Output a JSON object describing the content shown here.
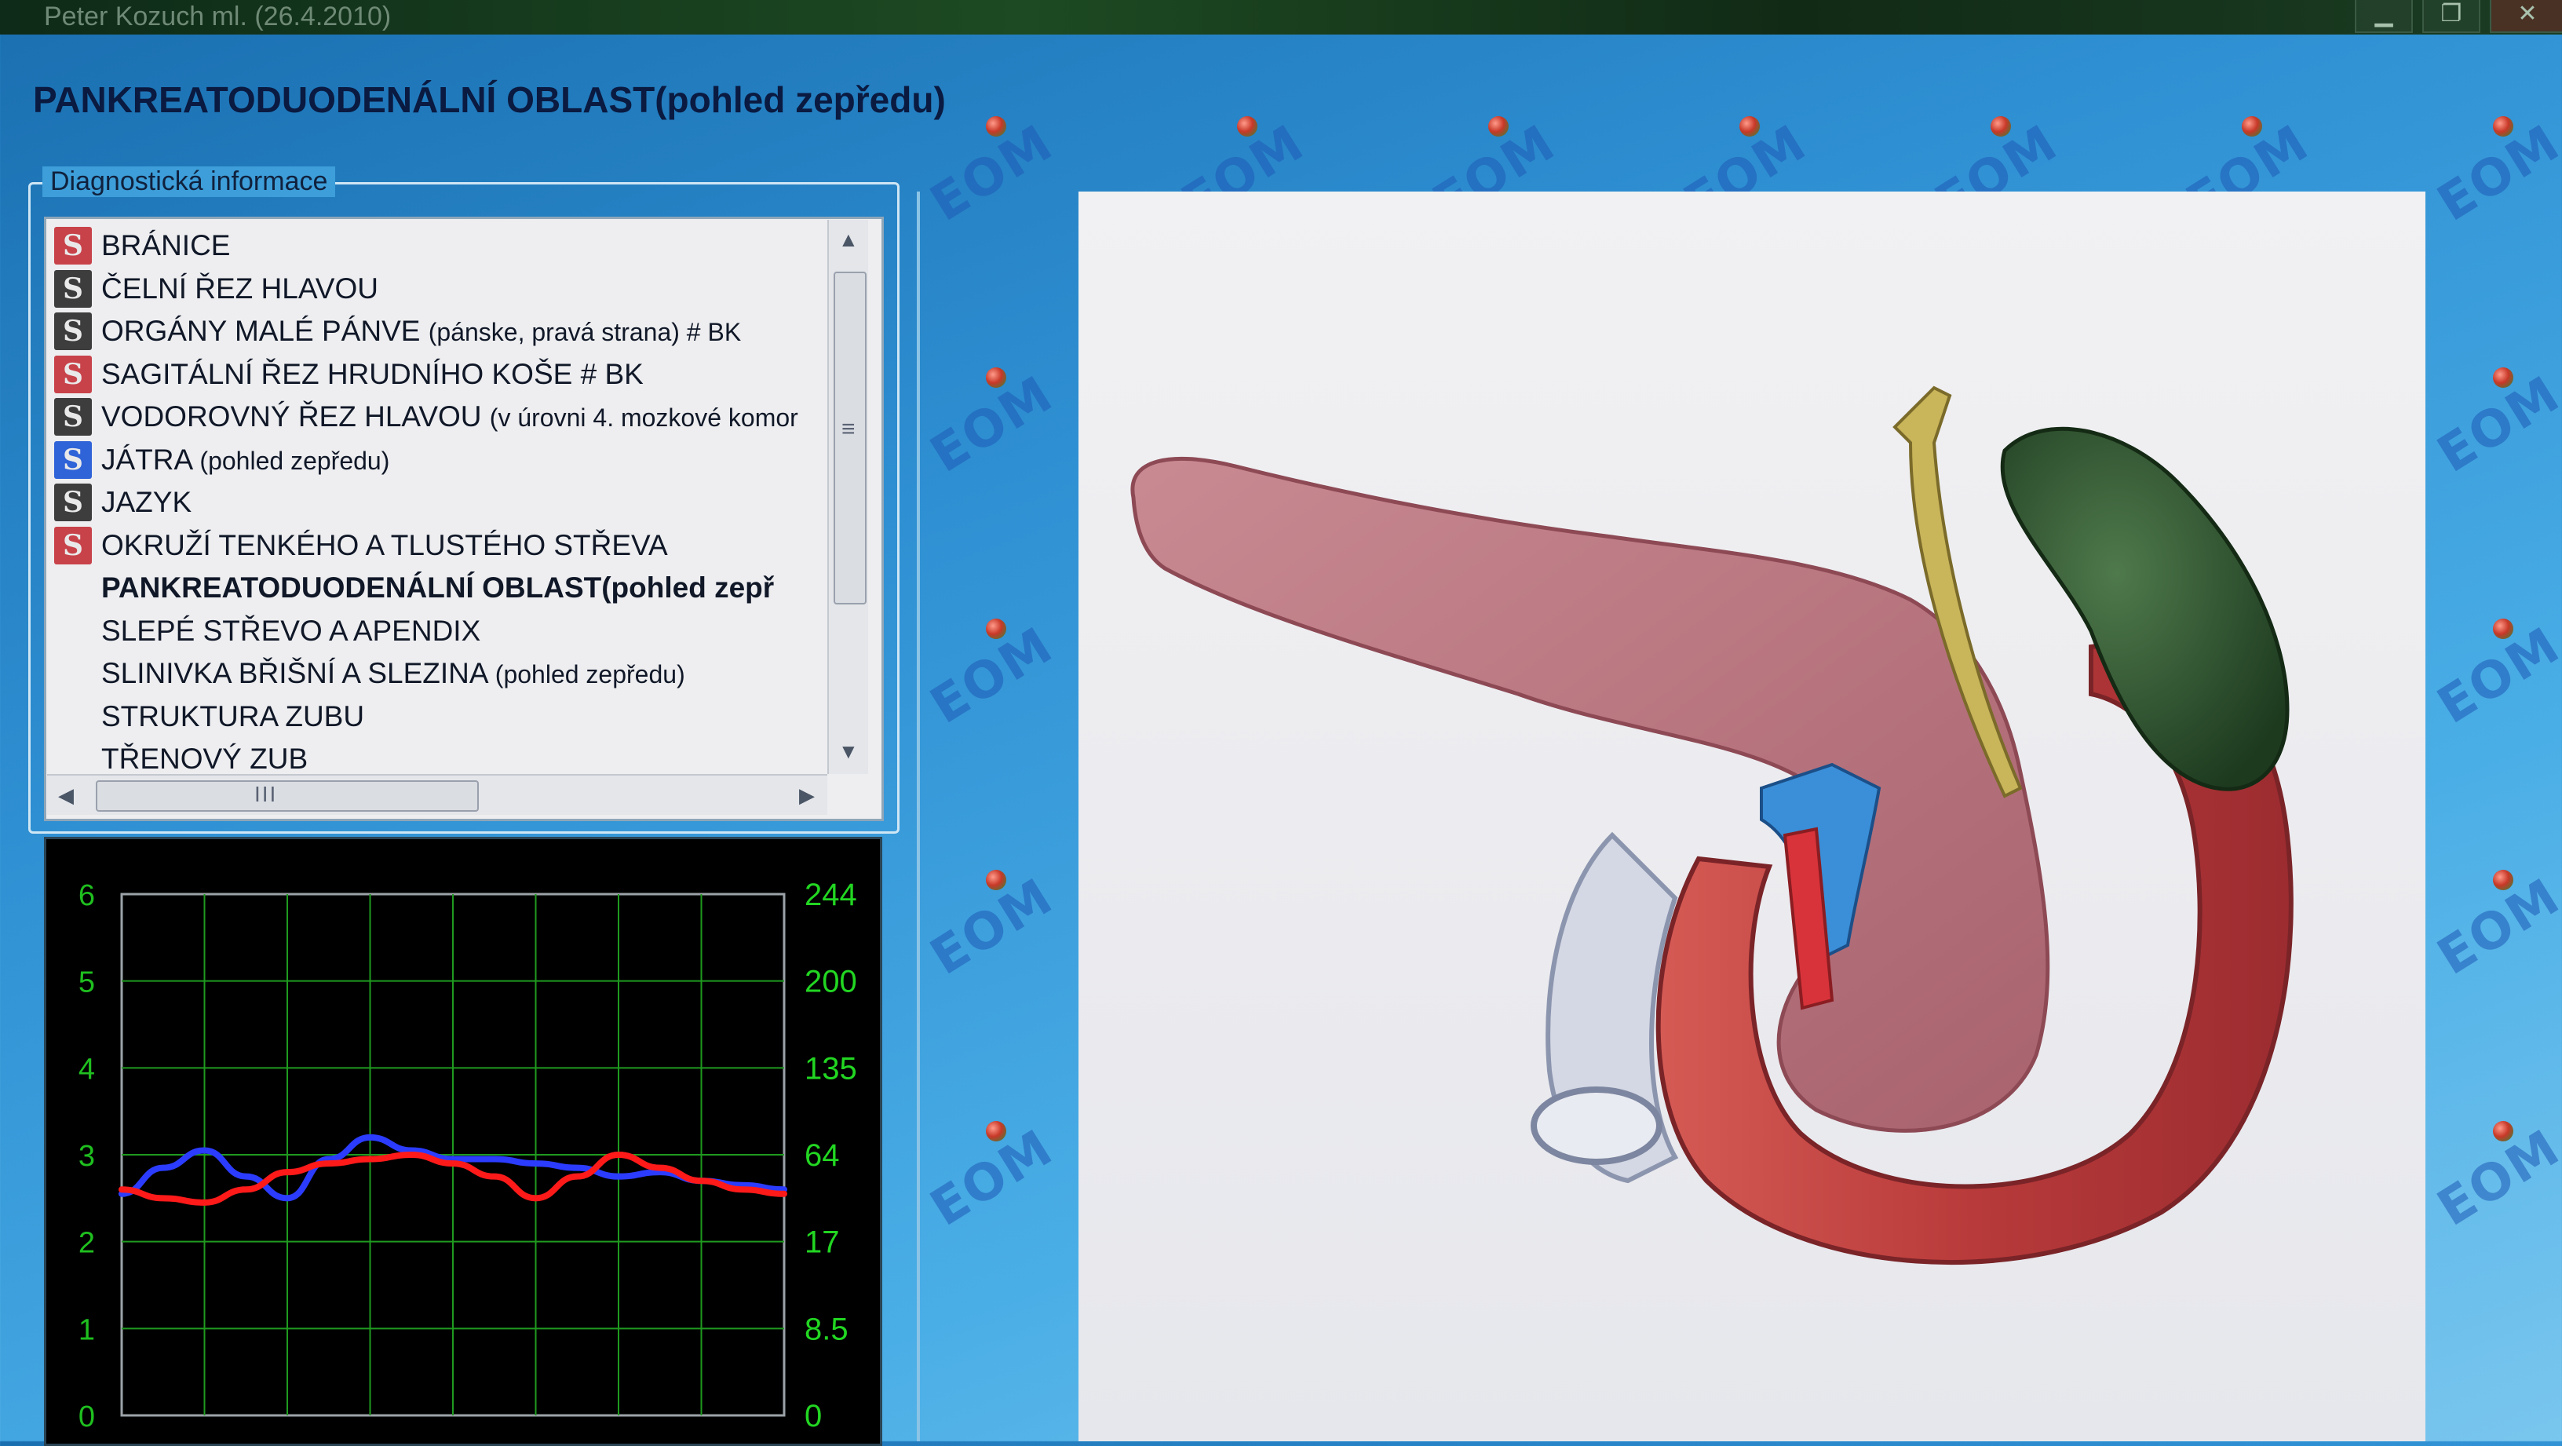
{
  "window": {
    "title": "Peter Kozuch ml. (26.4.2010)"
  },
  "page": {
    "title": "PANKREATODUODENÁLNÍ OBLAST(pohled zepředu)"
  },
  "diagnostic": {
    "legend": "Diagnostická informace",
    "items": [
      {
        "icon": "red",
        "main": "BRÁNICE",
        "sub": ""
      },
      {
        "icon": "dark",
        "main": "ČELNÍ ŘEZ HLAVOU",
        "sub": ""
      },
      {
        "icon": "dark",
        "main": "ORGÁNY MALÉ PÁNVE ",
        "sub": "(pánske, pravá strana) # BK"
      },
      {
        "icon": "red",
        "main": "SAGITÁLNÍ ŘEZ HRUDNÍHO KOŠE # BK",
        "sub": ""
      },
      {
        "icon": "dark",
        "main": "VODOROVNÝ ŘEZ HLAVOU ",
        "sub": "(v úrovni 4. mozkové komor"
      },
      {
        "icon": "blue",
        "main": "JÁTRA ",
        "sub": "(pohled zepředu)"
      },
      {
        "icon": "dark",
        "main": "JAZYK",
        "sub": ""
      },
      {
        "icon": "red",
        "main": "OKRUŽÍ TENKÉHO A TLUSTÉHO STŘEVA",
        "sub": ""
      },
      {
        "icon": "none",
        "main": "PANKREATODUODENÁLNÍ OBLAST(pohled zepř",
        "sub": "",
        "selected": true
      },
      {
        "icon": "none",
        "main": "SLEPÉ STŘEVO A  APENDIX",
        "sub": ""
      },
      {
        "icon": "none",
        "main": "SLINIVKA BŘIŠNÍ A SLEZINA  ",
        "sub": "(pohled zepředu)"
      },
      {
        "icon": "none",
        "main": "STRUKTURA ZUBU",
        "sub": ""
      },
      {
        "icon": "none",
        "main": "TŘENOVÝ ZUB",
        "sub": ""
      }
    ],
    "icon_letter": "S"
  },
  "scrollbar": {
    "h_thumb_grip": "III",
    "v_thumb_grip": "≡"
  },
  "icons": {
    "minimize": "minimize-icon",
    "maximize": "maximize-icon",
    "close": "close-icon",
    "scroll_up": "arrow-up-icon",
    "scroll_down": "arrow-down-icon",
    "scroll_left": "arrow-left-icon",
    "scroll_right": "arrow-right-icon"
  },
  "watermark": {
    "text": "EOM"
  },
  "chart_data": {
    "type": "line",
    "left_axis": {
      "ticks": [
        "6",
        "5",
        "4",
        "3",
        "2",
        "1",
        "0"
      ],
      "range": [
        0,
        6
      ]
    },
    "right_axis": {
      "ticks": [
        "244",
        "200",
        "135",
        "64",
        "17",
        "8.5",
        "0"
      ]
    },
    "grid": true,
    "series": [
      {
        "color": "#2b3cff",
        "x": [
          0,
          0.5,
          1,
          1.5,
          2,
          2.5,
          3,
          3.5,
          4,
          4.5,
          5,
          5.5,
          6,
          6.5,
          7,
          7.5,
          8
        ],
        "y": [
          2.55,
          2.85,
          3.05,
          2.75,
          2.5,
          2.95,
          3.2,
          3.05,
          2.95,
          2.95,
          2.9,
          2.85,
          2.75,
          2.8,
          2.7,
          2.65,
          2.6
        ]
      },
      {
        "color": "#ff1a1a",
        "x": [
          0,
          0.5,
          1,
          1.5,
          2,
          2.5,
          3,
          3.5,
          4,
          4.5,
          5,
          5.5,
          6,
          6.5,
          7,
          7.5,
          8
        ],
        "y": [
          2.6,
          2.5,
          2.45,
          2.6,
          2.8,
          2.9,
          2.95,
          3.0,
          2.9,
          2.75,
          2.5,
          2.75,
          3.0,
          2.85,
          2.7,
          2.6,
          2.55
        ]
      }
    ],
    "colors": {
      "background": "#000000",
      "grid": "#1f9a1f",
      "left_ticks": "#1fbf1f",
      "right_ticks": "#22d622"
    }
  }
}
